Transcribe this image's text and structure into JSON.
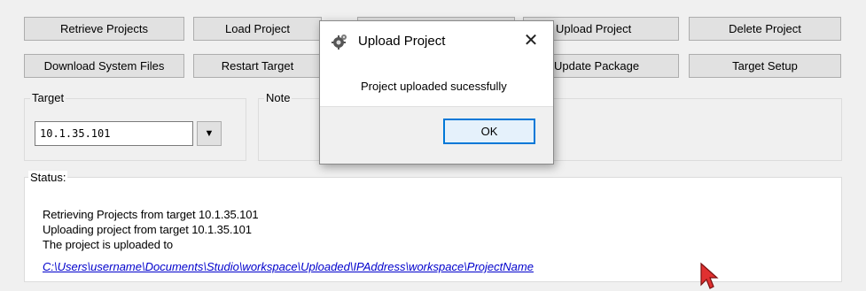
{
  "toolbar": {
    "row1": [
      "Retrieve Projects",
      "Load Project",
      "",
      "Upload Project",
      "Delete Project"
    ],
    "row2": [
      "Download System Files",
      "Restart Target",
      "",
      "Update Package",
      "Target Setup"
    ]
  },
  "target": {
    "label": "Target",
    "value": "10.1.35.101"
  },
  "note": {
    "label": "Note"
  },
  "status": {
    "label": "Status:",
    "lines": [
      "Retrieving Projects from target 10.1.35.101",
      "Uploading  project from target 10.1.35.101",
      "The project is uploaded to"
    ],
    "link": "C:\\Users\\username\\Documents\\Studio\\workspace\\Uploaded\\IPAddress\\workspace\\ProjectName"
  },
  "dialog": {
    "title": "Upload Project",
    "message": "Project uploaded sucessfully",
    "ok_label": "OK",
    "close_glyph": "✕",
    "icon": "gear-icon"
  },
  "colors": {
    "accent": "#0078d7",
    "link": "#0000cc",
    "cursor": "#e03030"
  }
}
